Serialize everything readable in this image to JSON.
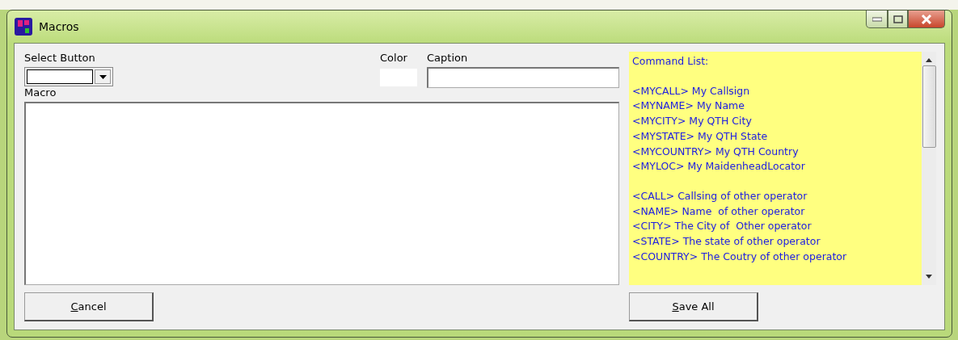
{
  "window": {
    "title": "Macros"
  },
  "select_button": {
    "label": "Select Button"
  },
  "color": {
    "label": "Color"
  },
  "caption": {
    "label": "Caption"
  },
  "macro": {
    "label": "Macro"
  },
  "command_list": {
    "title": "Command List:",
    "groups": [
      [
        "<MYCALL> My Callsign",
        "<MYNAME> My Name",
        "<MYCITY> My QTH City",
        "<MYSTATE> My QTH State",
        "<MYCOUNTRY> My QTH Country",
        "<MYLOC> My MaidenheadLocator"
      ],
      [
        "<CALL> Callsing of other operator",
        "<NAME> Name  of other operator",
        "<CITY> The City of  Other operator",
        "<STATE> The state of other operator",
        "<COUNTRY> The Coutry of other operator"
      ]
    ]
  },
  "buttons": [
    {
      "label": "Cancel",
      "underline_first_letter": true
    },
    {
      "label": "Save All",
      "underline_first_letter": true
    }
  ]
}
